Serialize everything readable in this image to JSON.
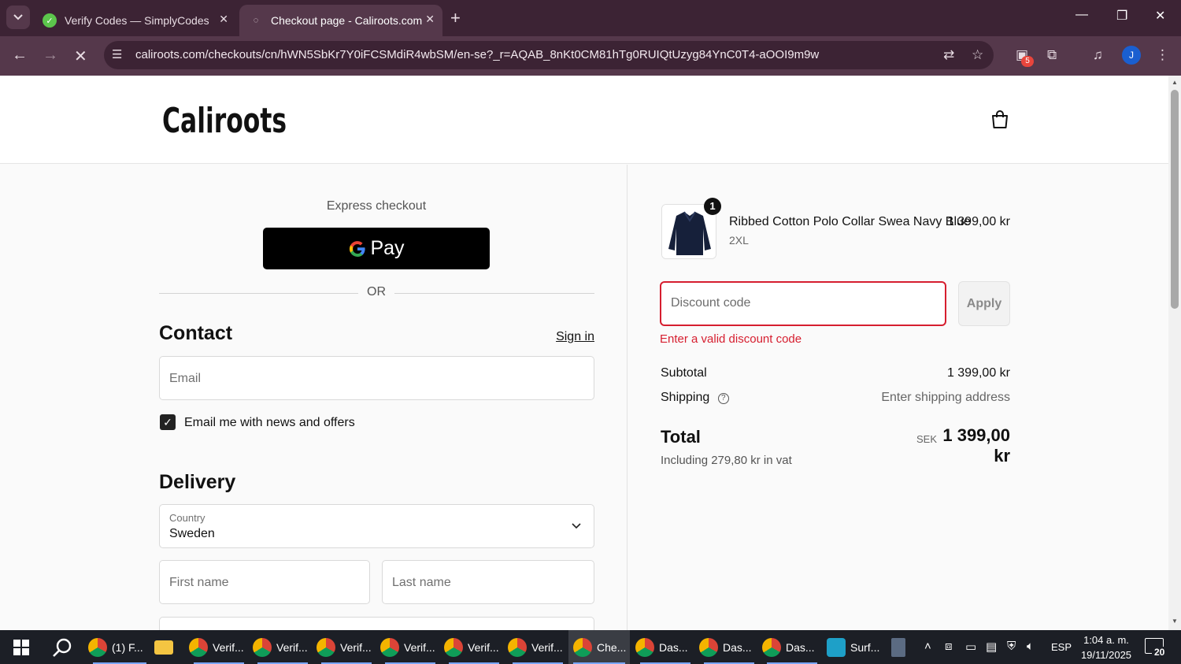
{
  "browser": {
    "tabs": [
      {
        "title": "Verify Codes — SimplyCodes",
        "active": false
      },
      {
        "title": "Checkout page - Caliroots.com",
        "active": true
      }
    ],
    "url": "caliroots.com/checkouts/cn/hWN5SbKr7Y0iFCSMdiR4wbSM/en-se?_r=AQAB_8nKt0CM81hTg0RUIQtUzyg84YnC0T4-aOOI9m9w",
    "extensions_badge": "5",
    "profile_initial": "J"
  },
  "site": {
    "logo_text": "Caliroots"
  },
  "checkout": {
    "express_label": "Express checkout",
    "gpay_label": "Pay",
    "or_label": "OR",
    "contact": {
      "heading": "Contact",
      "sign_in": "Sign in",
      "email_placeholder": "Email",
      "newsletter_label": "Email me with news and offers",
      "newsletter_checked": true
    },
    "delivery": {
      "heading": "Delivery",
      "country_label": "Country",
      "country_value": "Sweden",
      "first_name_placeholder": "First name",
      "last_name_placeholder": "Last name"
    }
  },
  "summary": {
    "item": {
      "quantity": "1",
      "name": "Ribbed Cotton Polo Collar Swea Navy Blue",
      "variant": "2XL",
      "price": "1 399,00 kr"
    },
    "discount_placeholder": "Discount code",
    "apply_label": "Apply",
    "error": "Enter a valid discount code",
    "subtotal_label": "Subtotal",
    "subtotal_value": "1 399,00 kr",
    "shipping_label": "Shipping",
    "shipping_value": "Enter shipping address",
    "total_label": "Total",
    "currency": "SEK",
    "total_value": "1 399,00 kr",
    "vat_note": "Including 279,80 kr in vat"
  },
  "taskbar": {
    "items": [
      {
        "label": "(1) F..."
      },
      {
        "label": ""
      },
      {
        "label": "Verif..."
      },
      {
        "label": "Verif..."
      },
      {
        "label": "Verif..."
      },
      {
        "label": "Verif..."
      },
      {
        "label": "Verif..."
      },
      {
        "label": "Verif..."
      },
      {
        "label": "Che..."
      },
      {
        "label": "Das..."
      },
      {
        "label": "Das..."
      },
      {
        "label": "Das..."
      },
      {
        "label": "Surf..."
      }
    ],
    "language": "ESP",
    "time": "1:04 a. m.",
    "date": "19/11/2025",
    "notifications": "20"
  }
}
